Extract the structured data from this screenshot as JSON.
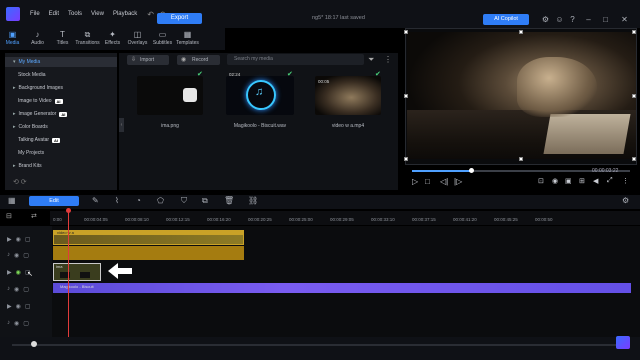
{
  "titlebar": {
    "menu": [
      "File",
      "Edit",
      "Tools",
      "View",
      "Playback"
    ],
    "export_label": "Export",
    "project_title": "ng5* 18:17 last saved",
    "ai_copilot_label": "AI Copilot"
  },
  "tabs": [
    {
      "label": "Media",
      "icon": "media-icon",
      "active": true
    },
    {
      "label": "Audio",
      "icon": "music-icon"
    },
    {
      "label": "Titles",
      "icon": "titles-icon"
    },
    {
      "label": "Transitions",
      "icon": "transitions-icon"
    },
    {
      "label": "Effects",
      "icon": "effects-icon"
    },
    {
      "label": "Overlays",
      "icon": "overlays-icon"
    },
    {
      "label": "Subtitles",
      "icon": "subtitles-icon"
    },
    {
      "label": "Templates",
      "icon": "templates-icon"
    }
  ],
  "sidebar": {
    "items": [
      {
        "label": "My Media",
        "active": true,
        "caret": "▾"
      },
      {
        "label": "Stock Media",
        "caret": ""
      },
      {
        "label": "Background Images",
        "caret": "▸"
      },
      {
        "label": "Image to Video",
        "caret": "",
        "badge": "AI"
      },
      {
        "label": "Image Generator",
        "caret": "▸",
        "badge": "AI"
      },
      {
        "label": "Color Boards",
        "caret": "▸"
      },
      {
        "label": "Talking Avatar",
        "caret": "",
        "badge": "AI"
      },
      {
        "label": "My Projects",
        "caret": ""
      },
      {
        "label": "Brand Kits",
        "caret": "▸"
      }
    ]
  },
  "media_toolbar": {
    "import_label": "Import",
    "record_label": "Record",
    "search_placeholder": "Search my media"
  },
  "media": [
    {
      "name": "ima.png",
      "duration": ""
    },
    {
      "name": "Magikoolo - Biscuit.wav",
      "duration": "02:24"
    },
    {
      "name": "video w a.mp4",
      "duration": "00:05"
    }
  ],
  "preview": {
    "progress": 0.22,
    "timecode": "00:00:03:22"
  },
  "timeline": {
    "edit_label": "Edit",
    "ruler": [
      "0:00",
      "00:00:04:05",
      "00:00:08:10",
      "00:00:12:15",
      "00:00:16:20",
      "00:00:20:25",
      "00:00:25:00",
      "00:00:29:05",
      "00:00:33:10",
      "00:00:37:15",
      "00:00:41:20",
      "00:00:45:25",
      "00:00:50"
    ],
    "clips": {
      "video": "video w a",
      "image": "ima",
      "audio": "Magikoolo - Biscuit"
    }
  },
  "colors": {
    "accent": "#2f7df6",
    "playhead": "#e23b3b",
    "video_clip": "#c9a227",
    "audio_clip": "#6a56e8"
  }
}
